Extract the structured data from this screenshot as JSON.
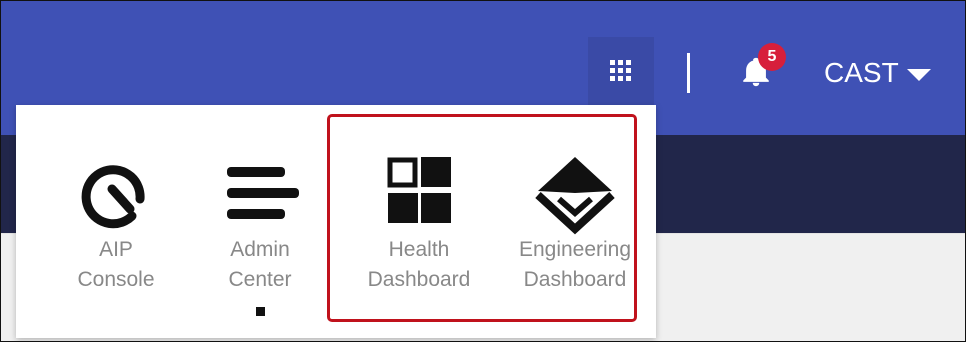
{
  "header": {
    "notification_count": "5",
    "user_name": "CAST"
  },
  "icons": {
    "apps": "grid-icon",
    "notifications": "bell-icon",
    "dropdown": "caret-down-icon"
  },
  "colors": {
    "topbar": "#3f51b5",
    "subbar": "#21264a",
    "badge": "#d71f3b",
    "highlight": "#c0121c",
    "label": "#888888"
  },
  "apps_menu": {
    "items": [
      {
        "line1": "AIP",
        "line2": "Console",
        "icon": "gauge-icon"
      },
      {
        "line1": "Admin",
        "line2": "Center",
        "icon": "admin-bars-icon"
      },
      {
        "line1": "Health",
        "line2": "Dashboard",
        "icon": "health-grid-icon"
      },
      {
        "line1": "Engineering",
        "line2": "Dashboard",
        "icon": "engineering-diamond-icon"
      }
    ]
  }
}
